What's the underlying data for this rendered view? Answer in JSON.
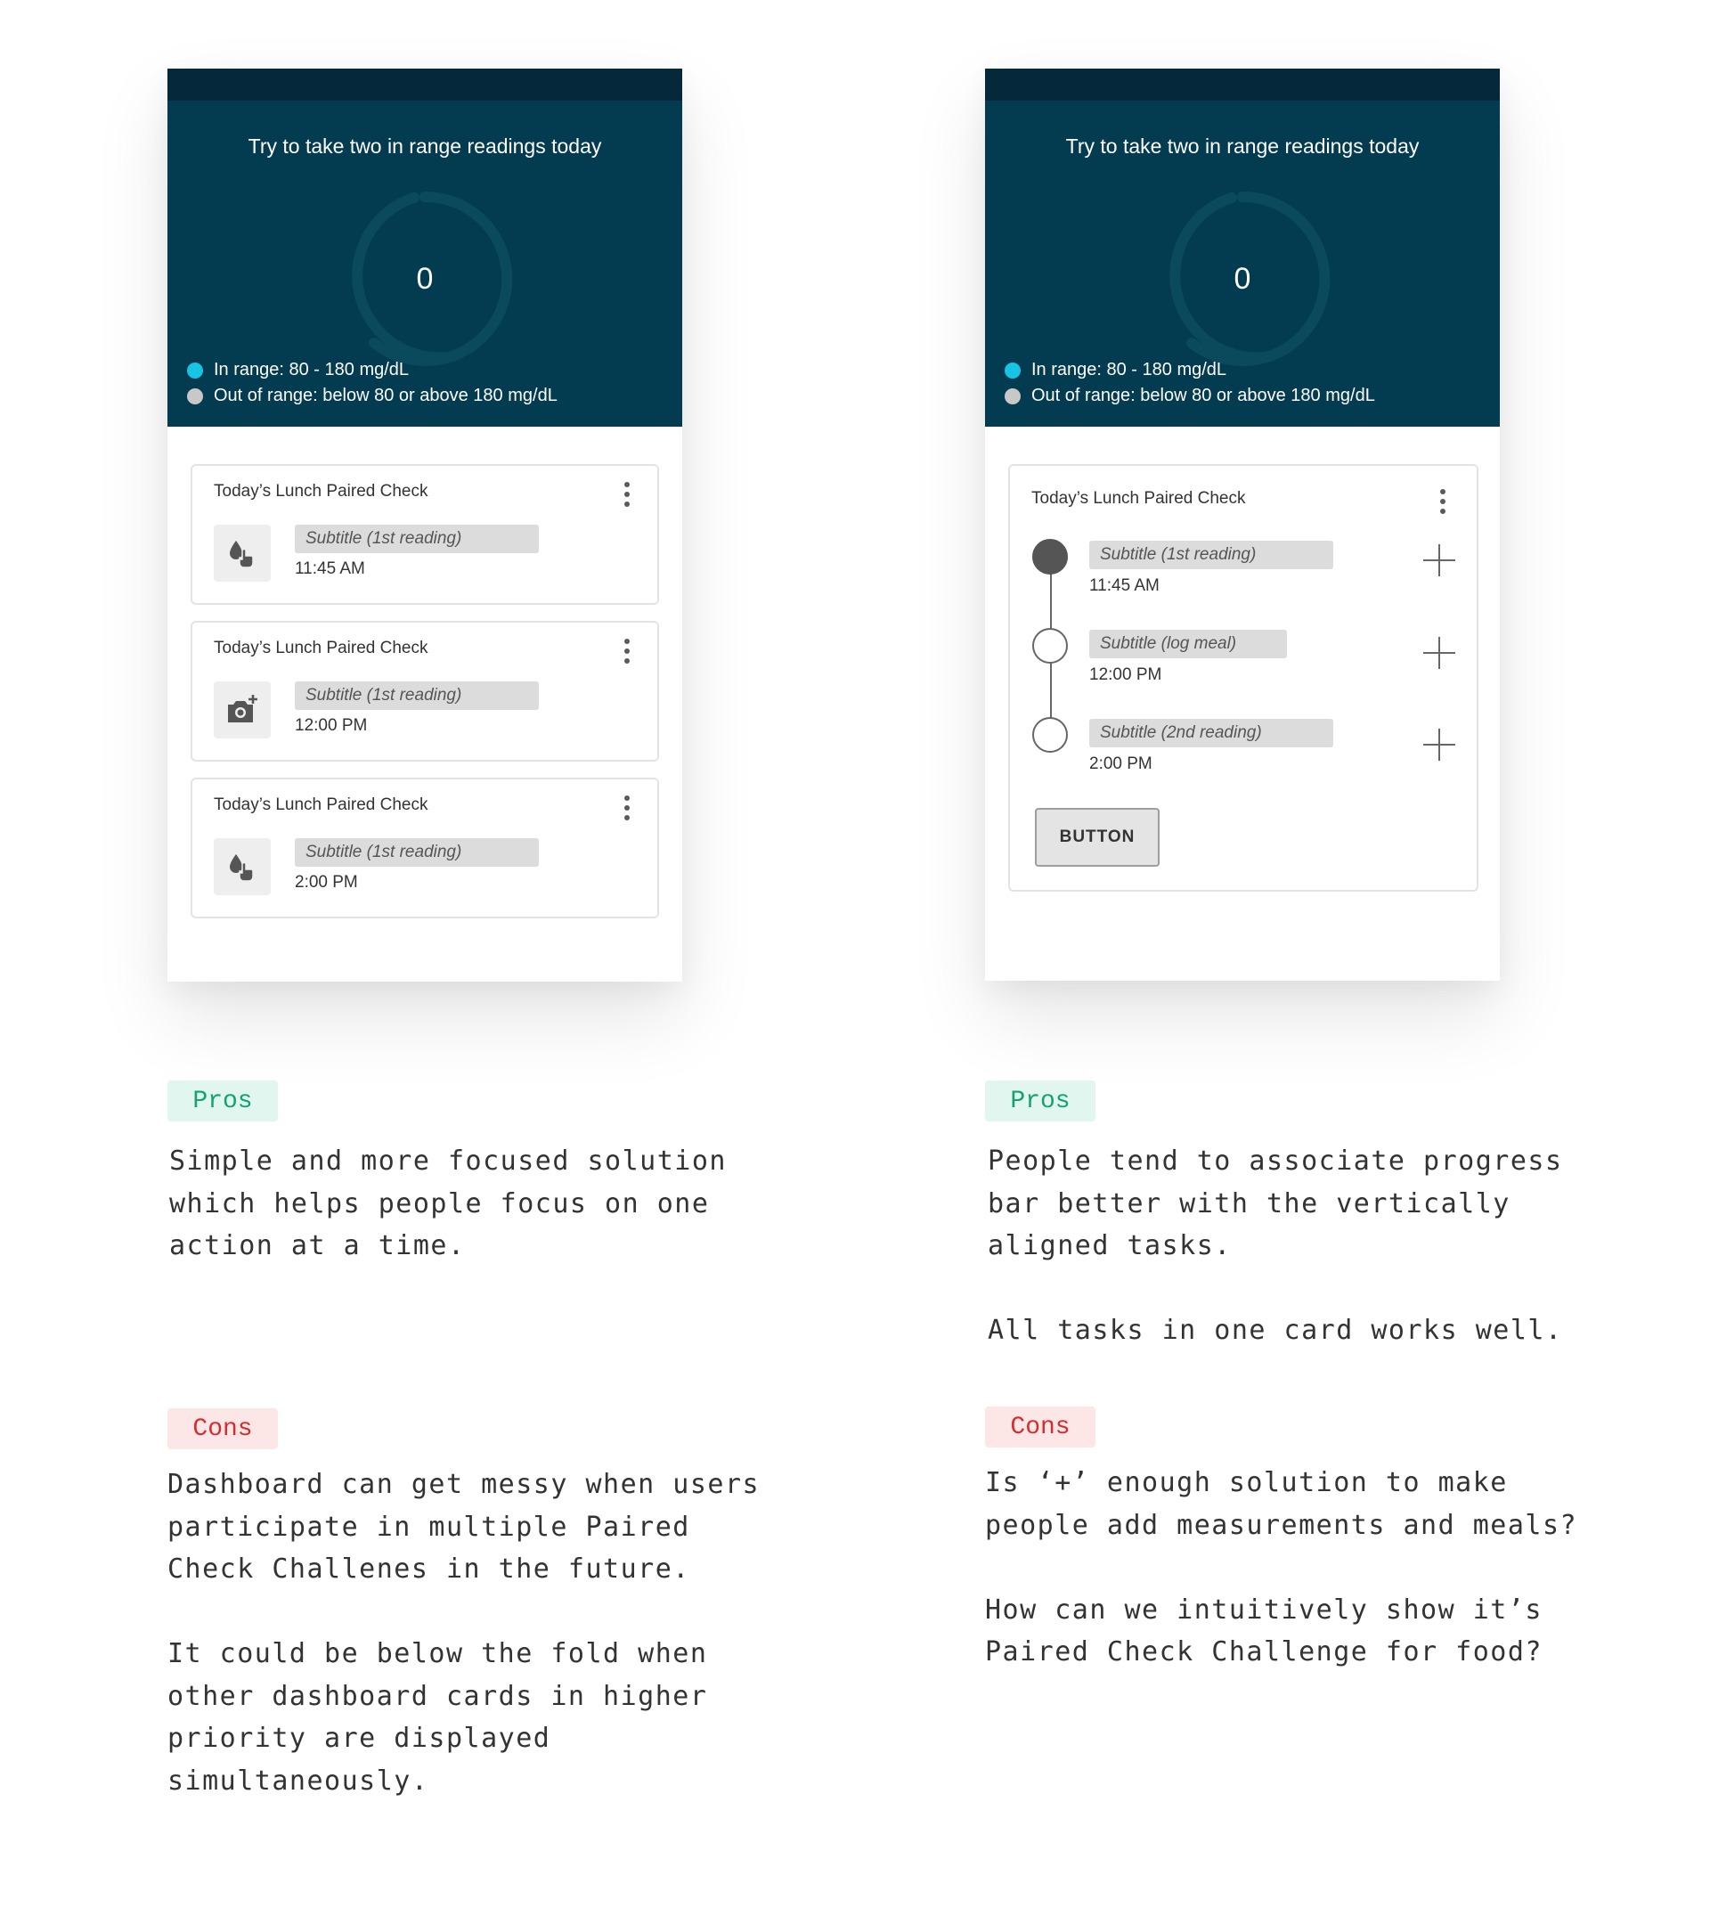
{
  "colors": {
    "hero_bg": "#033b50",
    "status_bar": "#05283a",
    "in_range_dot": "#19c3e3",
    "out_range_dot": "#c8c8c8",
    "pros_bg": "#e0f6ee",
    "pros_text": "#14a173",
    "cons_bg": "#fde6e6",
    "cons_text": "#d52d2d"
  },
  "left": {
    "hero": {
      "title": "Try to take two in range readings today",
      "count": "0",
      "legend_in": "In range: 80 - 180 mg/dL",
      "legend_out": "Out of range: below 80 or above 180 mg/dL"
    },
    "cards": [
      {
        "title": "Today’s Lunch Paired Check",
        "icon": "blood-drop-finger-icon",
        "subtitle": "Subtitle (1st reading)",
        "time": "11:45 AM"
      },
      {
        "title": "Today’s Lunch Paired Check",
        "icon": "add-photo-camera-icon",
        "subtitle": "Subtitle (1st reading)",
        "time": "12:00 PM"
      },
      {
        "title": "Today’s Lunch Paired Check",
        "icon": "blood-drop-finger-icon",
        "subtitle": "Subtitle (1st reading)",
        "time": "2:00 PM"
      }
    ],
    "pros_label": "Pros",
    "pros_text": "Simple and more focused solution\nwhich helps people focus on one\naction at a time.",
    "cons_label": "Cons",
    "cons_text": "Dashboard can get messy when users\nparticipate in multiple Paired\nCheck Challenes in the future.\n\nIt could be below the fold when\nother dashboard cards in higher\npriority are displayed\nsimultaneously."
  },
  "right": {
    "hero": {
      "title": "Try to take two in range readings today",
      "count": "0",
      "legend_in": "In range: 80 - 180 mg/dL",
      "legend_out": "Out of range: below 80 or above 180 mg/dL"
    },
    "card": {
      "title": "Today’s Lunch Paired Check",
      "steps": [
        {
          "subtitle": "Subtitle (1st reading)",
          "time": "11:45 AM",
          "state": "completed"
        },
        {
          "subtitle": "Subtitle (log meal)",
          "time": "12:00 PM",
          "state": "pending"
        },
        {
          "subtitle": "Subtitle (2nd reading)",
          "time": "2:00 PM",
          "state": "pending"
        }
      ],
      "button_label": "BUTTON"
    },
    "pros_label": "Pros",
    "pros_text": "People tend to associate progress\nbar better with the vertically\naligned tasks.\n\nAll tasks in one card works well.",
    "cons_label": "Cons",
    "cons_text": "Is ‘+’ enough solution to make\npeople add measurements and meals?\n\nHow can we intuitively show it’s\nPaired Check Challenge for food?"
  }
}
